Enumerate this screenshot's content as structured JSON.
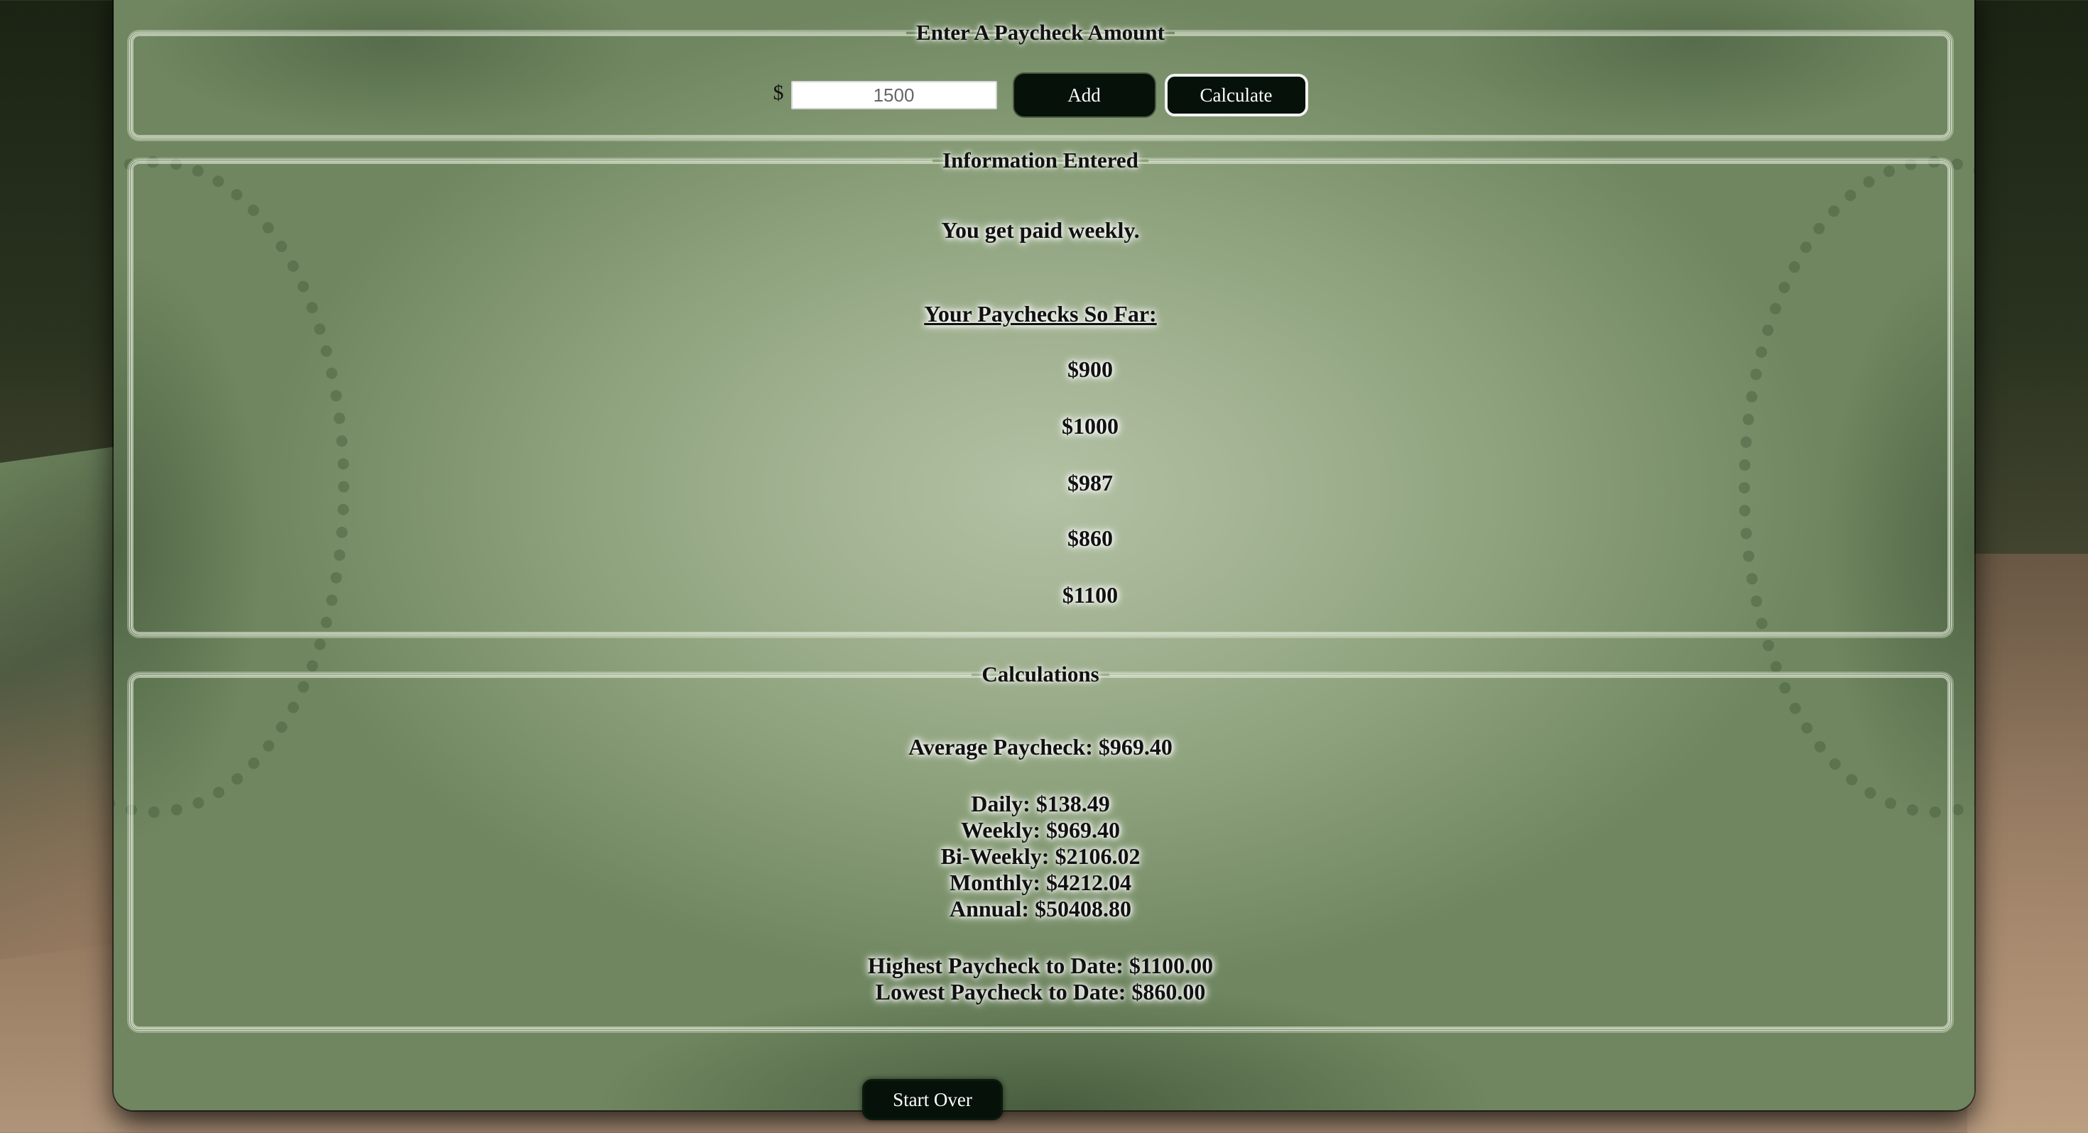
{
  "entry": {
    "legend": "Enter A Paycheck Amount",
    "currency_symbol": "$",
    "amount_value": "1500",
    "add_label": "Add",
    "calculate_label": "Calculate"
  },
  "info": {
    "legend": "Information Entered",
    "frequency_text": "You get paid weekly.",
    "paychecks_heading": "Your Paychecks So Far:",
    "paychecks": [
      "$900",
      "$1000",
      "$987",
      "$860",
      "$1100"
    ]
  },
  "calc": {
    "legend": "Calculations",
    "average": "Average Paycheck: $969.40",
    "daily": "Daily: $138.49",
    "weekly": "Weekly: $969.40",
    "biweekly": "Bi-Weekly: $2106.02",
    "monthly": "Monthly: $4212.04",
    "annual": "Annual: $50408.80",
    "highest": "Highest Paycheck to Date: $1100.00",
    "lowest": "Lowest Paycheck to Date: $860.00"
  },
  "footer": {
    "start_over_label": "Start Over"
  }
}
